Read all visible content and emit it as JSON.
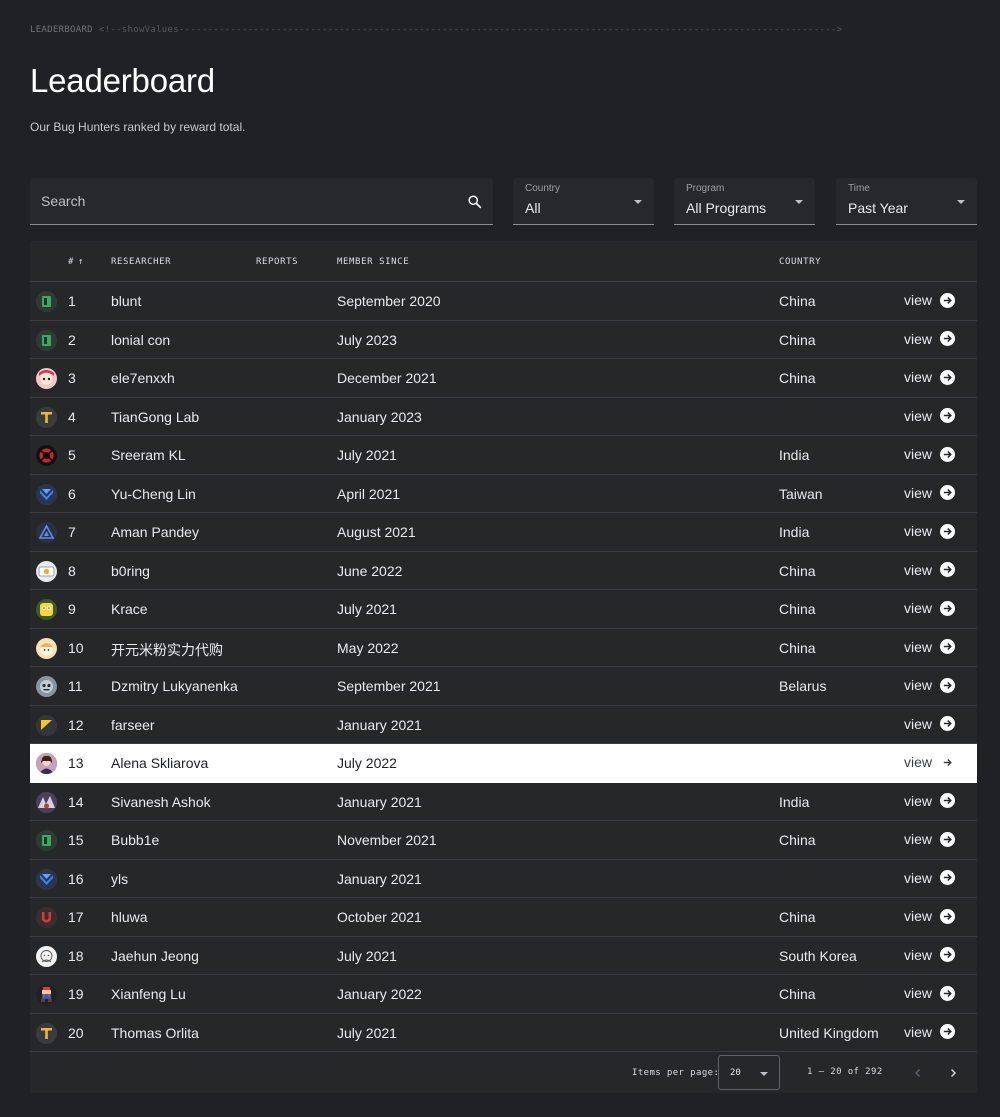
{
  "breadcrumb": {
    "label": "LEADERBOARD",
    "comment": "<!--showValues------------------------------------------------------------------------------------------------------------------->"
  },
  "header": {
    "title": "Leaderboard",
    "subtitle": "Our Bug Hunters ranked by reward total."
  },
  "filters": {
    "search_placeholder": "Search",
    "country": {
      "label": "Country",
      "value": "All"
    },
    "program": {
      "label": "Program",
      "value": "All Programs"
    },
    "time": {
      "label": "Time",
      "value": "Past Year"
    }
  },
  "table": {
    "columns": {
      "rank": "#",
      "rank_sort": "↑",
      "researcher": "RESEARCHER",
      "reports": "REPORTS",
      "member_since": "MEMBER SINCE",
      "country": "COUNTRY"
    },
    "view_label": "view",
    "highlight_rank": 13,
    "rows": [
      {
        "rank": "1",
        "name": "blunt",
        "member_since": "September 2020",
        "country": "China",
        "avatar": "green-square-avatar"
      },
      {
        "rank": "2",
        "name": "lonial con",
        "member_since": "July 2023",
        "country": "China",
        "avatar": "green-square-avatar"
      },
      {
        "rank": "3",
        "name": "ele7enxxh",
        "member_since": "December 2021",
        "country": "China",
        "avatar": "anime-face-avatar"
      },
      {
        "rank": "4",
        "name": "TianGong Lab",
        "member_since": "January 2023",
        "country": "",
        "avatar": "yellow-t-avatar"
      },
      {
        "rank": "5",
        "name": "Sreeram KL",
        "member_since": "July 2021",
        "country": "India",
        "avatar": "red-black-avatar"
      },
      {
        "rank": "6",
        "name": "Yu-Cheng Lin",
        "member_since": "April 2021",
        "country": "Taiwan",
        "avatar": "blue-shield-avatar"
      },
      {
        "rank": "7",
        "name": "Aman Pandey",
        "member_since": "August 2021",
        "country": "India",
        "avatar": "blue-triangle-avatar"
      },
      {
        "rank": "8",
        "name": "b0ring",
        "member_since": "June 2022",
        "country": "China",
        "avatar": "white-card-avatar"
      },
      {
        "rank": "9",
        "name": "Krace",
        "member_since": "July 2021",
        "country": "China",
        "avatar": "sponge-avatar"
      },
      {
        "rank": "10",
        "name": "开元米粉实力代购",
        "member_since": "May 2022",
        "country": "China",
        "avatar": "cartoon-avatar"
      },
      {
        "rank": "11",
        "name": "Dzmitry Lukyanenka",
        "member_since": "September 2021",
        "country": "Belarus",
        "avatar": "grey-face-avatar"
      },
      {
        "rank": "12",
        "name": "farseer",
        "member_since": "January 2021",
        "country": "",
        "avatar": "yellow-flag-avatar"
      },
      {
        "rank": "13",
        "name": "Alena Skliarova",
        "member_since": "July 2022",
        "country": "",
        "avatar": "photo-avatar"
      },
      {
        "rank": "14",
        "name": "Sivanesh Ashok",
        "member_since": "January 2021",
        "country": "India",
        "avatar": "character-avatar"
      },
      {
        "rank": "15",
        "name": "Bubb1e",
        "member_since": "November 2021",
        "country": "China",
        "avatar": "green-square-avatar"
      },
      {
        "rank": "16",
        "name": "yls",
        "member_since": "January 2021",
        "country": "",
        "avatar": "blue-shield-avatar"
      },
      {
        "rank": "17",
        "name": "hluwa",
        "member_since": "October 2021",
        "country": "China",
        "avatar": "red-u-avatar"
      },
      {
        "rank": "18",
        "name": "Jaehun Jeong",
        "member_since": "July 2021",
        "country": "South Korea",
        "avatar": "sketch-avatar"
      },
      {
        "rank": "19",
        "name": "Xianfeng Lu",
        "member_since": "January 2022",
        "country": "China",
        "avatar": "mario-avatar"
      },
      {
        "rank": "20",
        "name": "Thomas Orlita",
        "member_since": "July 2021",
        "country": "United Kingdom",
        "avatar": "yellow-t-avatar"
      }
    ]
  },
  "paginator": {
    "items_per_page_label": "Items per page:",
    "items_per_page": "20",
    "range_label": "1 – 20 of 292"
  },
  "colors": {
    "background": "#202124",
    "table": "#262729",
    "highlight_row": "#ffffff"
  }
}
